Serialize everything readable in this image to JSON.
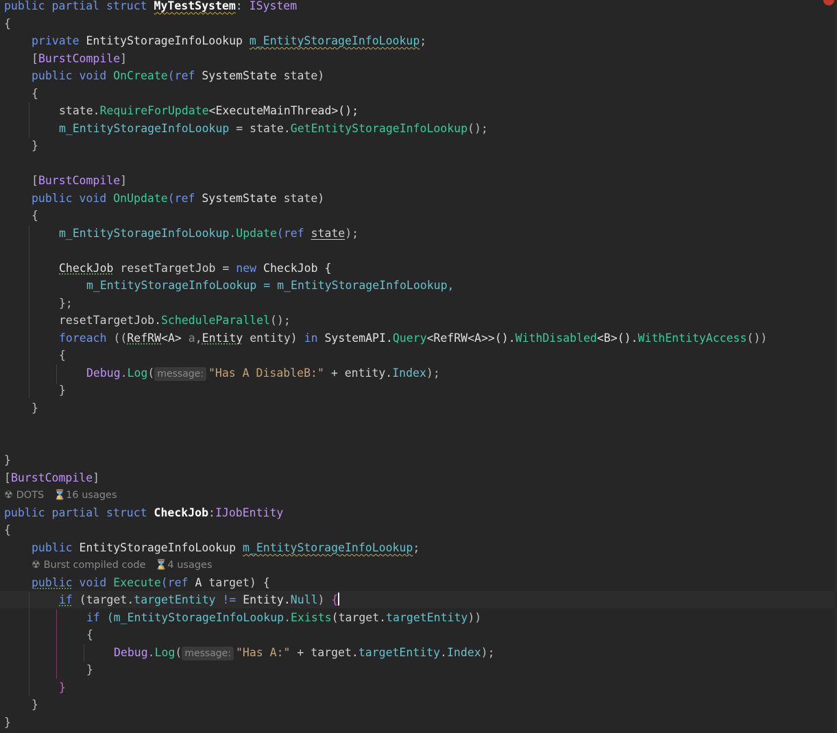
{
  "lines": {
    "l1_kw": "public partial struct ",
    "l1_name": "MyTestSystem",
    "l1_colon": ": ",
    "l1_iface": "ISystem",
    "open": "{",
    "close": "}",
    "l3_kw": "private ",
    "l3_type": "EntityStorageInfoLookup ",
    "l3_field": "m_EntityStorageInfoLookup",
    "semi": ";",
    "attr_open": "[",
    "attr_name": "BurstCompile",
    "attr_close": "]",
    "public_void": "public void ",
    "oncreate": "OnCreate",
    "paren_ref": "(ref ",
    "systemstate": "SystemState ",
    "state_param": "state)",
    "state_dot": "state.",
    "require": "RequireForUpdate",
    "require_gen": "<ExecuteMainThread>();",
    "assign_field": "m_EntityStorageInfoLookup",
    "assign_eq": " = state.",
    "getlookup": "GetEntityStorageInfoLookup",
    "call_end": "();",
    "onupdate": "OnUpdate",
    "upd_field": "m_EntityStorageInfoLookup.",
    "update_fn": "Update",
    "upd_args_open": "(ref ",
    "upd_state": "state",
    "upd_end": ");",
    "checkjob": "CheckJob",
    "reset_decl": " resetTargetJob = ",
    "new_kw": "new ",
    "checkjob2": "CheckJob {",
    "init_field": "m_EntityStorageInfoLookup",
    "init_eq": " = m_EntityStorageInfoLookup,",
    "close_semi": "};",
    "reset_dot": "resetTargetJob.",
    "sched": "ScheduleParallel",
    "foreach_kw": "foreach ",
    "fe_open": "((",
    "refrw": "RefRW",
    "fe_a": "<A> ",
    "fe_avar": "a",
    "fe_comma": ",",
    "fe_entity_t": "Entity",
    "fe_entity_v": " entity) ",
    "in_kw": "in ",
    "sysapi": "SystemAPI.",
    "query": "Query",
    "query_gen": "<RefRW<A>>().",
    "withdisabled": "WithDisabled",
    "wd_gen": "<B>().",
    "withentity": "WithEntityAccess",
    "fe_end": "())",
    "debug": "Debug.",
    "log": "Log",
    "log_open": "(",
    "msg_hint": "message:",
    "str1": "\"Has A DisableB:\"",
    "plus_entity": " + entity.",
    "index": "Index",
    "paren_end": ");",
    "hint_dots": "DOTS",
    "hint_usages16": "16 usages",
    "cj_kw": "public partial struct ",
    "cj_name": "CheckJob",
    "cj_colon": ":",
    "cj_iface": "IJobEntity",
    "pub": "public ",
    "cj_type": "EntityStorageInfoLookup ",
    "cj_field": "m_EntityStorageInfoLookup",
    "hint_burst": "Burst compiled code",
    "hint_usages4": "4 usages",
    "pub_kw": "public",
    "void_kw": " void ",
    "execute": "Execute",
    "ex_args": "(ref ",
    "ex_a": "A ",
    "ex_target": "target) {",
    "if_kw": "if",
    "if1_open": " (target.",
    "target_entity": "targetEntity",
    "neq": " != ",
    "entity_t": "Entity.",
    "null_f": "Null",
    "if1_end": ") ",
    "brace_open": "{",
    "if2_kw": "if ",
    "if2_open": "(m_EntityStorageInfoLookup.",
    "exists": "Exists",
    "if2_mid": "(target.",
    "if2_end": "))",
    "str2": "\"Has A:\"",
    "plus_target": " + target.",
    "dot": ".",
    "brace_close_pink": "}"
  }
}
